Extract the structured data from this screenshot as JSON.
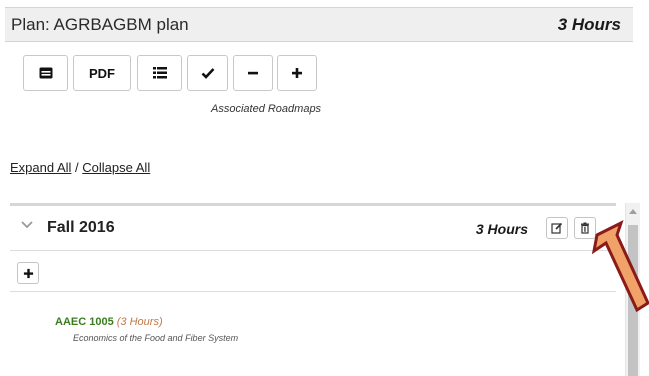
{
  "plan": {
    "title": "Plan: AGRBAGBM plan",
    "hours": "3 Hours"
  },
  "toolbar": {
    "pdf_label": "PDF",
    "associated_roadmaps": "Associated Roadmaps",
    "icons": [
      "card-icon",
      "pdf-text",
      "list-icon",
      "check-icon",
      "minus-icon",
      "plus-icon"
    ]
  },
  "links": {
    "expand_all": "Expand All",
    "separator": " / ",
    "collapse_all": "Collapse All"
  },
  "term": {
    "title": "Fall 2016",
    "hours": "3 Hours",
    "courses": [
      {
        "code": "AAEC 1005",
        "hours": "(3 Hours)",
        "title": "Economics of the Food and Fiber System"
      }
    ]
  },
  "colors": {
    "course_code": "#3a7d1e",
    "course_hours": "#c07a4a",
    "arrow_fill": "#f0a268",
    "arrow_stroke": "#8b1a1a",
    "header_bg": "#efefef"
  }
}
